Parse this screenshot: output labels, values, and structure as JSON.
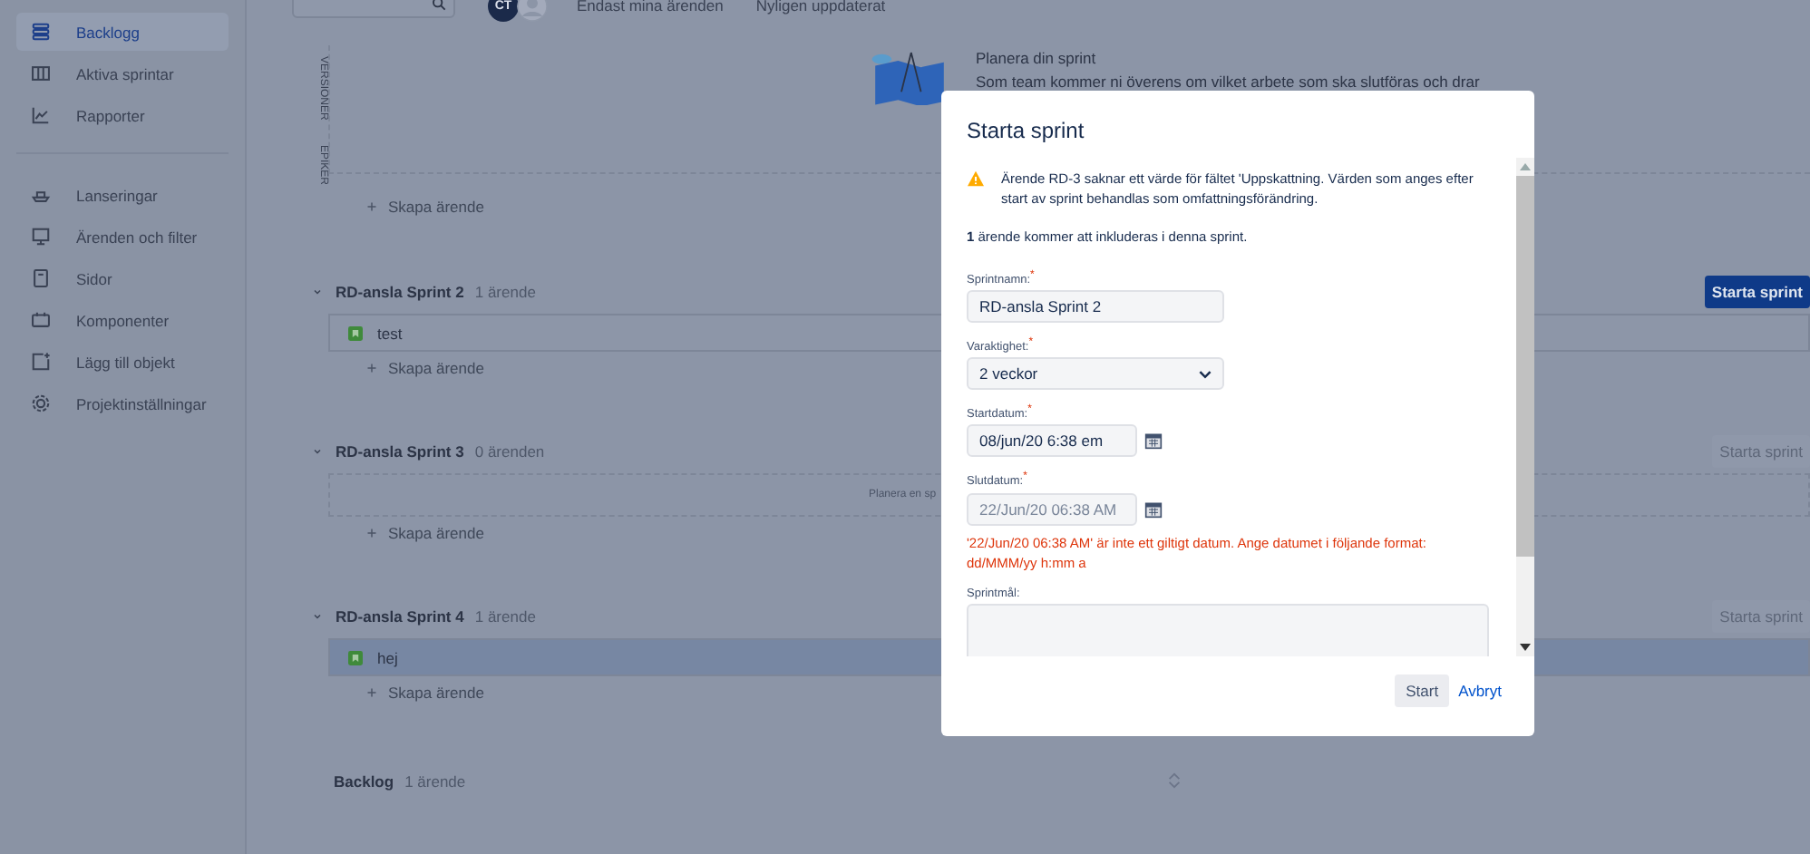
{
  "sidebar": {
    "groups": [
      {
        "items": [
          {
            "label": "Backlogg",
            "kind": "backlog",
            "selected": true
          },
          {
            "label": "Aktiva sprintar",
            "kind": "board",
            "selected": false
          },
          {
            "label": "Rapporter",
            "kind": "chart",
            "selected": false
          }
        ]
      },
      {
        "items": [
          {
            "label": "Lanseringar",
            "kind": "ship",
            "selected": false
          },
          {
            "label": "Ärenden och filter",
            "kind": "monitor",
            "selected": false
          },
          {
            "label": "Sidor",
            "kind": "page",
            "selected": false
          },
          {
            "label": "Komponenter",
            "kind": "calendar",
            "selected": false
          },
          {
            "label": "Lägg till objekt",
            "kind": "add",
            "selected": false
          },
          {
            "label": "Projektinställningar",
            "kind": "gear",
            "selected": false
          }
        ]
      }
    ]
  },
  "toolbar": {
    "avatars": [
      {
        "kind": "initials",
        "initials": "CT"
      },
      {
        "kind": "generic"
      }
    ],
    "filters": [
      "Endast mina ärenden",
      "Nyligen uppdaterat"
    ]
  },
  "planning": {
    "side_tabs": [
      "VERSIONER",
      "EPIKER"
    ],
    "title": "Planera din sprint",
    "text": "Som team kommer ni överens om vilket arbete som ska slutföras och drar",
    "create_label": "Skapa ärende"
  },
  "sprints": [
    {
      "name": "RD-ansla Sprint 2",
      "count": "1 ärende",
      "button": {
        "label": "Starta sprint",
        "primary": true
      },
      "issues": [
        {
          "summary": "test",
          "selected": false
        }
      ],
      "create_label": "Skapa ärende"
    },
    {
      "name": "RD-ansla Sprint 3",
      "count": "0 ärenden",
      "button": {
        "label": "Starta sprint",
        "primary": false
      },
      "empty_hint": "Planera en sp",
      "create_label": "Skapa ärende"
    },
    {
      "name": "RD-ansla Sprint 4",
      "count": "1 ärende",
      "button": {
        "label": "Starta sprint",
        "primary": false
      },
      "issues": [
        {
          "summary": "hej",
          "selected": true
        }
      ],
      "create_label": "Skapa ärende"
    }
  ],
  "backlog": {
    "name": "Backlog",
    "count": "1 ärende"
  },
  "dialog": {
    "title": "Starta sprint",
    "warning": "Ärende RD-3 saknar ett värde för fältet 'Uppskattning. Värden som anges efter start av sprint behandlas som omfattningsförändring.",
    "included": "**1** ärende kommer att inkluderas i denna sprint.",
    "fields": [
      {
        "kind": "text",
        "label": "Sprintnamn:",
        "required_mark": "*",
        "value": "RD-ansla Sprint 2"
      },
      {
        "kind": "select",
        "label": "Varaktighet:",
        "required_mark": "*",
        "value": "2 veckor"
      },
      {
        "kind": "date",
        "label": "Startdatum:",
        "required_mark": "*",
        "value": "08/jun/20 6:38 em",
        "disabled": false
      },
      {
        "kind": "date",
        "label": "Slutdatum:",
        "required_mark": "*",
        "value": "22/Jun/20 06:38 AM",
        "disabled": true,
        "error": "'22/Jun/20 06:38 AM' är inte ett giltigt datum. Ange datumet i följande format: dd/MMM/yy h:mm a"
      },
      {
        "kind": "textarea",
        "label": "Sprintmål:"
      }
    ],
    "buttons": [
      {
        "label": "Start",
        "kind": "primary"
      },
      {
        "label": "Avbryt",
        "kind": "link"
      }
    ]
  }
}
